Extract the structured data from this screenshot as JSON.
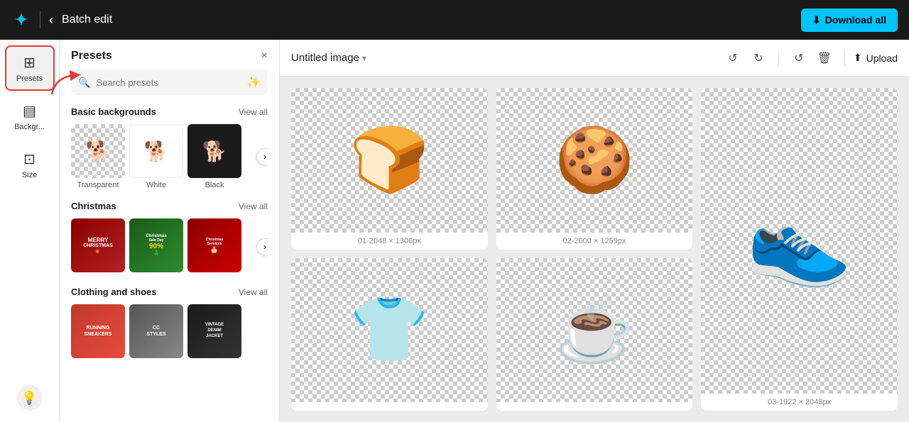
{
  "header": {
    "title": "Batch edit",
    "back_label": "‹",
    "download_label": "Download all",
    "logo_symbol": "✦"
  },
  "sidebar": {
    "items": [
      {
        "id": "presets",
        "label": "Presets",
        "icon": "⊞",
        "active": true
      },
      {
        "id": "background",
        "label": "Backgr...",
        "icon": "▤",
        "active": false
      },
      {
        "id": "size",
        "label": "Size",
        "icon": "⊡",
        "active": false
      }
    ],
    "hint_icon": "💡"
  },
  "presets_panel": {
    "title": "Presets",
    "close_label": "×",
    "search_placeholder": "Search presets",
    "sections": [
      {
        "id": "basic",
        "title": "Basic backgrounds",
        "view_all": "View all",
        "items": [
          {
            "id": "transparent",
            "label": "Transparent",
            "bg": "checker"
          },
          {
            "id": "white",
            "label": "White",
            "bg": "white"
          },
          {
            "id": "black",
            "label": "Black",
            "bg": "black"
          }
        ]
      },
      {
        "id": "christmas",
        "title": "Christmas",
        "view_all": "View all",
        "items": [
          {
            "id": "xmas1",
            "label": "Merry Christmas",
            "bg": "red"
          },
          {
            "id": "xmas2",
            "label": "Christmas Sale",
            "bg": "green"
          },
          {
            "id": "xmas3",
            "label": "Christmas Services",
            "bg": "darkred"
          }
        ]
      },
      {
        "id": "clothing",
        "title": "Clothing and shoes",
        "view_all": "View all",
        "items": [
          {
            "id": "cl1",
            "label": "Running Sneakers",
            "bg": "red"
          },
          {
            "id": "cl2",
            "label": "CC Styles",
            "bg": "gray"
          },
          {
            "id": "cl3",
            "label": "Vintage Denim Jacket",
            "bg": "dark"
          }
        ]
      }
    ]
  },
  "canvas": {
    "title": "Untitled image",
    "toolbar": {
      "undo_label": "↺",
      "redo_label": "↻",
      "refresh_label": "↺",
      "delete_label": "🗑",
      "upload_label": "Upload",
      "upload_icon": "⬆"
    },
    "images": [
      {
        "id": "01",
        "caption": "01-2048 × 1306px",
        "emoji": "🍞"
      },
      {
        "id": "02",
        "caption": "02-2000 × 1259px",
        "emoji": "🍪"
      },
      {
        "id": "03",
        "caption": "03-1922 × 2048px",
        "emoji": "👟",
        "tall": true
      },
      {
        "id": "04",
        "caption": "",
        "emoji": "👕"
      },
      {
        "id": "05",
        "caption": "",
        "emoji": "☕"
      }
    ]
  }
}
